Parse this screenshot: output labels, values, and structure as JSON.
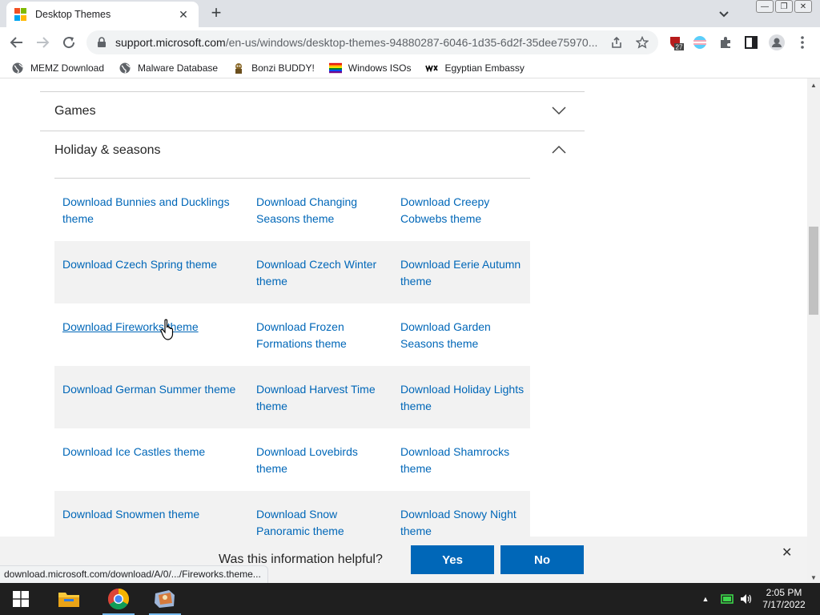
{
  "browser": {
    "tab_title": "Desktop Themes",
    "url_host": "support.microsoft.com",
    "url_path": "/en-us/windows/desktop-themes-94880287-6046-1d35-6d2f-35dee75970...",
    "extension_badge": "27"
  },
  "bookmarks": [
    {
      "label": "MEMZ Download",
      "icon": "globe-icon"
    },
    {
      "label": "Malware Database",
      "icon": "globe-icon"
    },
    {
      "label": "Bonzi BUDDY!",
      "icon": "bonzi-icon"
    },
    {
      "label": "Windows ISOs",
      "icon": "rainbow-flag-icon"
    },
    {
      "label": "Egyptian Embassy",
      "icon": "wix-icon"
    }
  ],
  "accordion": {
    "games_label": "Games",
    "holiday_label": "Holiday & seasons"
  },
  "themes": [
    [
      "Download Bunnies and Ducklings theme",
      "Download Changing Seasons theme",
      "Download Creepy Cobwebs theme"
    ],
    [
      "Download Czech Spring theme",
      "Download Czech Winter theme",
      "Download Eerie Autumn theme"
    ],
    [
      "Download Fireworks theme",
      "Download Frozen Formations theme",
      "Download Garden Seasons theme"
    ],
    [
      "Download German Summer theme",
      "Download Harvest Time theme",
      "Download Holiday Lights theme"
    ],
    [
      "Download Ice Castles theme",
      "Download Lovebirds theme",
      "Download Shamrocks theme"
    ],
    [
      "Download Snowmen theme",
      "Download Snow Panoramic theme",
      "Download Snowy Night theme"
    ]
  ],
  "feedback": {
    "question": "Was this information helpful?",
    "yes": "Yes",
    "no": "No"
  },
  "status_url": "download.microsoft.com/download/A/0/.../Fireworks.theme...",
  "clock": {
    "time": "2:05 PM",
    "date": "7/17/2022"
  },
  "colors": {
    "link": "#0067b8",
    "button": "#0067b8",
    "taskbar": "#1f1f1f"
  }
}
